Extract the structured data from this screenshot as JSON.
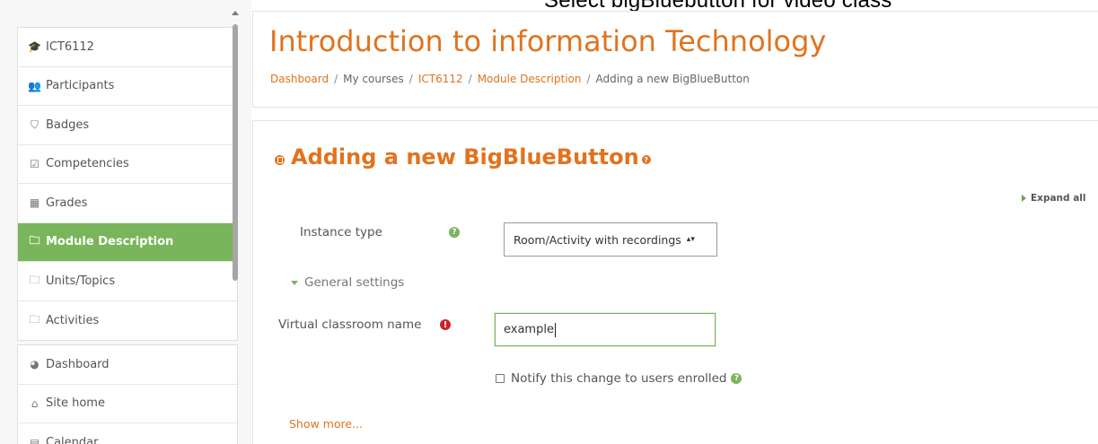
{
  "caption": "Select bigBluebutton for video class",
  "sidebar": {
    "course_items": [
      {
        "label": "ICT6112",
        "icon": "graduation-cap-icon",
        "glyph": "🎓"
      },
      {
        "label": "Participants",
        "icon": "users-icon",
        "glyph": "👥"
      },
      {
        "label": "Badges",
        "icon": "shield-icon",
        "glyph": "⛉"
      },
      {
        "label": "Competencies",
        "icon": "check-square-icon",
        "glyph": "☑"
      },
      {
        "label": "Grades",
        "icon": "table-icon",
        "glyph": "▦"
      },
      {
        "label": "Module Description",
        "icon": "folder-icon",
        "glyph": "🗀",
        "active": true
      },
      {
        "label": "Units/Topics",
        "icon": "folder-icon",
        "glyph": "🗀"
      },
      {
        "label": "Activities",
        "icon": "folder-icon",
        "glyph": "🗀"
      }
    ],
    "site_items": [
      {
        "label": "Dashboard",
        "icon": "dashboard-icon",
        "glyph": "◕"
      },
      {
        "label": "Site home",
        "icon": "home-icon",
        "glyph": "⌂"
      },
      {
        "label": "Calendar",
        "icon": "calendar-icon",
        "glyph": "▤"
      }
    ]
  },
  "header": {
    "course_title": "Introduction to information Technology",
    "breadcrumb": [
      {
        "label": "Dashboard",
        "link": true
      },
      {
        "label": "My courses",
        "link": false
      },
      {
        "label": "ICT6112",
        "link": true
      },
      {
        "label": "Module Description",
        "link": true
      },
      {
        "label": "Adding a new BigBlueButton",
        "link": false
      }
    ]
  },
  "main": {
    "heading": "Adding a new BigBlueButton",
    "expand_all": "Expand all",
    "instance_type_label": "Instance type",
    "instance_type_value": "Room/Activity with recordings",
    "general_settings": "General settings",
    "name_label": "Virtual classroom name",
    "name_value": "example",
    "notify_label": "Notify this change to users enrolled",
    "show_more": "Show more..."
  },
  "colors": {
    "accent_orange": "#e1731e",
    "accent_green": "#79b55b",
    "required_red": "#c9222c"
  }
}
